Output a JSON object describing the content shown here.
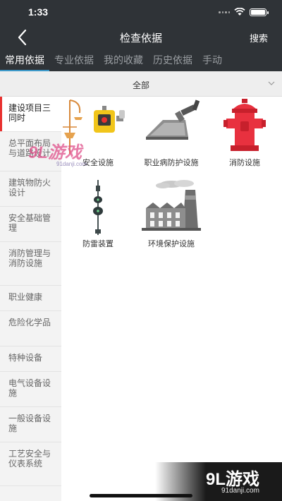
{
  "status": {
    "time": "1:33"
  },
  "nav": {
    "title": "检查依据",
    "search_label": "搜索"
  },
  "tabs": [
    {
      "label": "常用依据",
      "active": true
    },
    {
      "label": "专业依据",
      "active": false
    },
    {
      "label": "我的收藏",
      "active": false
    },
    {
      "label": "历史依据",
      "active": false
    },
    {
      "label": "手动",
      "active": false
    }
  ],
  "filter": {
    "label": "全部"
  },
  "sidebar": {
    "items": [
      {
        "label": "建设项目三同时",
        "active": true
      },
      {
        "label": "总平面布局与道路设计",
        "active": false
      },
      {
        "label": "建筑物防火设计",
        "active": false
      },
      {
        "label": "安全基础管理",
        "active": false
      },
      {
        "label": "消防管理与消防设施",
        "active": false
      },
      {
        "label": "职业健康",
        "active": false
      },
      {
        "label": "危险化学品",
        "active": false
      },
      {
        "label": "特种设备",
        "active": false
      },
      {
        "label": "电气设备设施",
        "active": false
      },
      {
        "label": "一般设备设施",
        "active": false
      },
      {
        "label": "工艺安全与仪表系统",
        "active": false
      }
    ]
  },
  "grid": [
    {
      "label": "安全设施",
      "icon": "safety-equipment-icon"
    },
    {
      "label": "职业病防护设施",
      "icon": "occupational-protection-icon"
    },
    {
      "label": "消防设施",
      "icon": "fire-hydrant-icon"
    },
    {
      "label": "防雷装置",
      "icon": "lightning-rod-icon"
    },
    {
      "label": "环境保护设施",
      "icon": "factory-icon"
    }
  ],
  "watermark": {
    "text1": "9L游戏",
    "url1": "91danji.com",
    "text2": "9L游戏",
    "url2": "91danji.com"
  },
  "colors": {
    "header": "#2f3337",
    "accent_tab": "#3c98c9",
    "active_side": "#e8312f",
    "hydrant": "#e8313f"
  }
}
